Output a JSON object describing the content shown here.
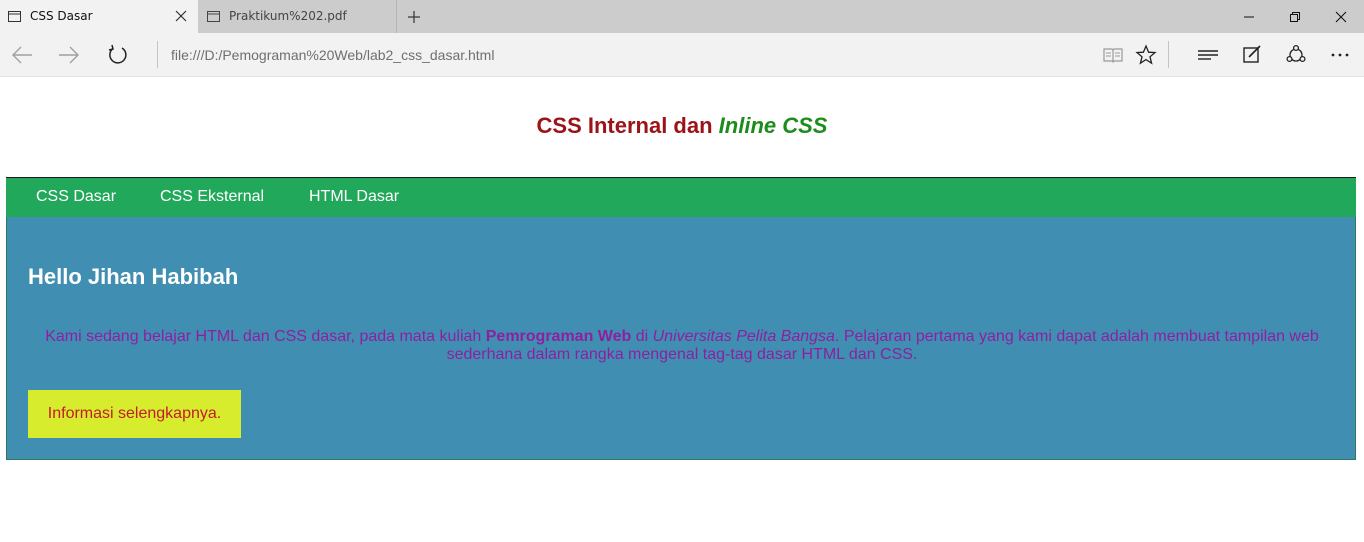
{
  "browser": {
    "tabs": [
      {
        "title": "CSS Dasar",
        "active": true
      },
      {
        "title": "Praktikum%202.pdf",
        "active": false
      }
    ],
    "address": "file:///D:/Pemograman%20Web/lab2_css_dasar.html"
  },
  "page": {
    "title_part1": "CSS Internal dan ",
    "title_part2": "Inline CSS",
    "menu": [
      "CSS Dasar",
      "CSS Eksternal",
      "HTML Dasar"
    ],
    "greeting": "Hello Jihan Habibah",
    "intro": {
      "t1": "Kami sedang belajar HTML dan CSS dasar, pada mata kuliah ",
      "bold": "Pemrograman Web",
      "t2": " di ",
      "italic": "Universitas Pelita Bangsa",
      "t3": ". Pelajaran pertama yang kami dapat adalah membuat tampilan web sederhana dalam rangka mengenal tag-tag dasar HTML dan CSS."
    },
    "button": "Informasi selengkapnya."
  },
  "colors": {
    "title_red": "#9b1217",
    "title_green": "#1c8d1c",
    "menu_bg": "#22a85a",
    "content_bg": "#408fb2",
    "intro_text": "#8e1fa1",
    "button_bg": "#d8ec2e",
    "button_text": "#c41b2b"
  },
  "icons": [
    "page-icon",
    "close-icon",
    "plus-icon",
    "minimize-icon",
    "restore-icon",
    "back-icon",
    "forward-icon",
    "refresh-icon",
    "reading-view-icon",
    "star-icon",
    "hub-icon",
    "note-icon",
    "share-icon",
    "more-icon"
  ]
}
